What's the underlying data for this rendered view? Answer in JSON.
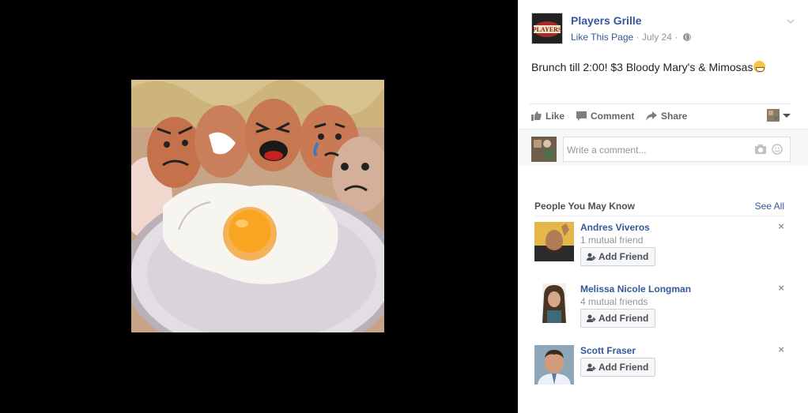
{
  "post": {
    "page_name": "Players Grille",
    "logo_text": "PLAYERS",
    "like_page": "Like This Page",
    "date": "July 24",
    "separator": "·",
    "text": "Brunch till 2:00! $3 Bloody Mary's & Mimosas",
    "emoji": "grinning-face-emoji"
  },
  "actions": {
    "like": "Like",
    "comment": "Comment",
    "share": "Share"
  },
  "comment_box": {
    "placeholder": "Write a comment..."
  },
  "people_you_may_know": {
    "title": "People You May Know",
    "see_all": "See All",
    "add_friend_label": "Add Friend",
    "close_glyph": "×",
    "people": [
      {
        "name": "Andres Viveros",
        "mutual": "1 mutual friend"
      },
      {
        "name": "Melissa Nicole Longman",
        "mutual": "4 mutual friends"
      },
      {
        "name": "Scott Fraser",
        "mutual": ""
      }
    ]
  },
  "colors": {
    "link_blue": "#365899",
    "muted_gray": "#90949c",
    "panel_background": "#ffffff",
    "stage_background": "#000000"
  }
}
